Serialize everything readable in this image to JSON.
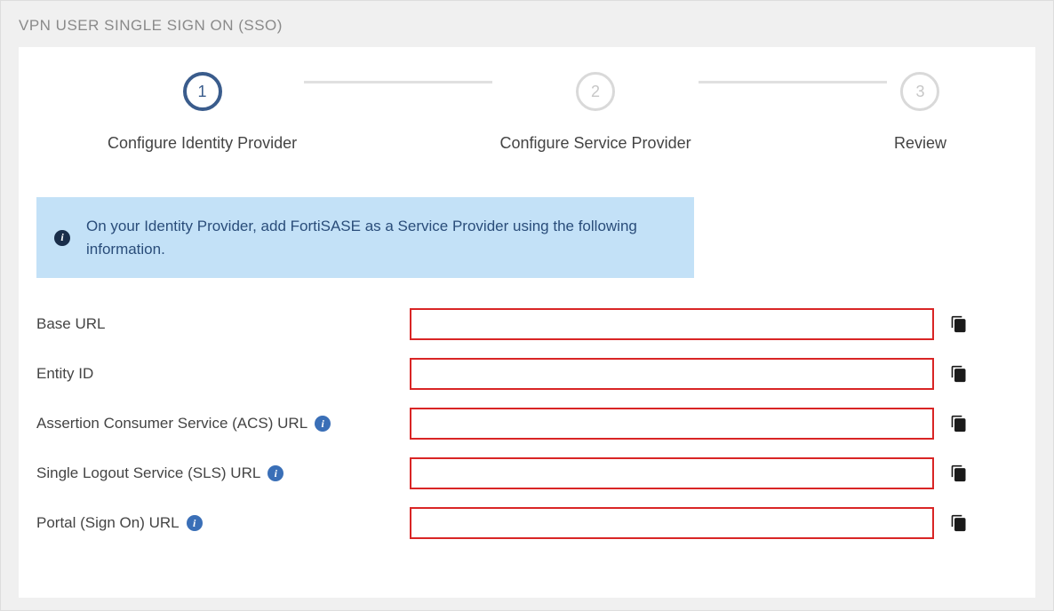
{
  "header": {
    "title": "VPN USER SINGLE SIGN ON (SSO)"
  },
  "stepper": {
    "steps": [
      {
        "number": "1",
        "label": "Configure Identity Provider",
        "active": true
      },
      {
        "number": "2",
        "label": "Configure Service Provider",
        "active": false
      },
      {
        "number": "3",
        "label": "Review",
        "active": false
      }
    ]
  },
  "banner": {
    "text": "On your Identity Provider, add FortiSASE as a Service Provider using the following information."
  },
  "fields": [
    {
      "label": "Base URL",
      "hasInfo": false,
      "value": ""
    },
    {
      "label": "Entity ID",
      "hasInfo": false,
      "value": ""
    },
    {
      "label": "Assertion Consumer Service (ACS) URL",
      "hasInfo": true,
      "value": ""
    },
    {
      "label": "Single Logout Service (SLS) URL",
      "hasInfo": true,
      "value": ""
    },
    {
      "label": "Portal (Sign On) URL",
      "hasInfo": true,
      "value": ""
    }
  ]
}
